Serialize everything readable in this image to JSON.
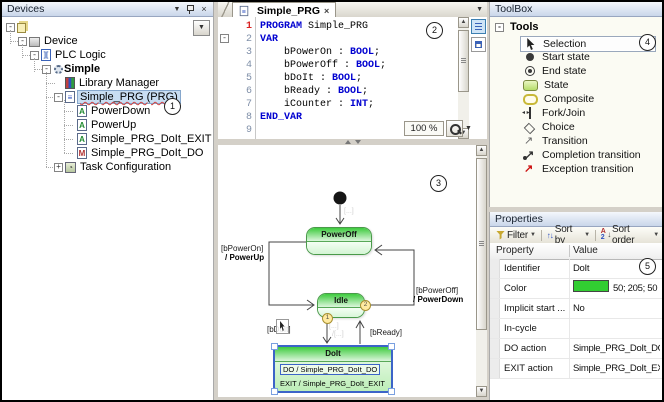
{
  "icons": {
    "close": "×",
    "dropdown": "▼",
    "up": "▲",
    "down": "▼"
  },
  "annotations": {
    "a1": "1",
    "a2": "2",
    "a3": "3",
    "a4": "4",
    "a5": "5"
  },
  "devices_panel": {
    "title": "Devices",
    "tree": [
      {
        "label": "",
        "level": 0,
        "icon": "project",
        "expander": "-",
        "name": "root"
      },
      {
        "label": "Device",
        "level": 1,
        "icon": "device",
        "expander": "-",
        "name": "device"
      },
      {
        "label": "PLC Logic",
        "level": 2,
        "icon": "plc",
        "expander": "-",
        "name": "plc-logic"
      },
      {
        "label": "Simple",
        "level": 3,
        "icon": "app",
        "expander": "-",
        "bold": true,
        "name": "simple"
      },
      {
        "label": "Library Manager",
        "level": 4,
        "icon": "library",
        "name": "library-manager"
      },
      {
        "label": "Simple_PRG (PRG)",
        "level": 4,
        "icon": "pou",
        "expander": "-",
        "selected": true,
        "annotation": "1",
        "name": "simple-prg"
      },
      {
        "label": "PowerDown",
        "level": 5,
        "icon": "action",
        "name": "powerdown"
      },
      {
        "label": "PowerUp",
        "level": 5,
        "icon": "action",
        "name": "powerup"
      },
      {
        "label": "Simple_PRG_DoIt_EXIT",
        "level": 5,
        "icon": "action",
        "name": "simple-prg-doit-exit"
      },
      {
        "label": "Simple_PRG_DoIt_DO",
        "level": 5,
        "icon": "method",
        "name": "simple-prg-doit-do"
      },
      {
        "label": "Task Configuration",
        "level": 4,
        "icon": "task",
        "expander": "+",
        "name": "task-configuration"
      }
    ]
  },
  "editor": {
    "tab_title": "Simple_PRG",
    "zoom_level": "100 %",
    "lines": [
      {
        "n": "1",
        "cur": true,
        "parts": [
          [
            "PROGRAM",
            "kw"
          ],
          [
            " Simple_PRG",
            "pl"
          ]
        ]
      },
      {
        "n": "2",
        "fold": true,
        "parts": [
          [
            "VAR",
            "kw"
          ]
        ]
      },
      {
        "n": "3",
        "parts": [
          [
            "    bPowerOn : ",
            "pl"
          ],
          [
            "BOOL",
            "ty"
          ],
          [
            ";",
            "pl"
          ]
        ]
      },
      {
        "n": "4",
        "parts": [
          [
            "    bPowerOff : ",
            "pl"
          ],
          [
            "BOOL",
            "ty"
          ],
          [
            ";",
            "pl"
          ]
        ]
      },
      {
        "n": "5",
        "parts": [
          [
            "    bDoIt : ",
            "pl"
          ],
          [
            "BOOL",
            "ty"
          ],
          [
            ";",
            "pl"
          ]
        ]
      },
      {
        "n": "6",
        "parts": [
          [
            "    bReady : ",
            "pl"
          ],
          [
            "BOOL",
            "ty"
          ],
          [
            ";",
            "pl"
          ]
        ]
      },
      {
        "n": "7",
        "parts": [
          [
            "    iCounter : ",
            "pl"
          ],
          [
            "INT",
            "ty"
          ],
          [
            ";",
            "pl"
          ]
        ]
      },
      {
        "n": "8",
        "parts": [
          [
            "END_VAR",
            "kw"
          ]
        ]
      },
      {
        "n": "9",
        "parts": []
      }
    ]
  },
  "diagram": {
    "states": {
      "poweroff": "PowerOff",
      "idle": "Idle",
      "doit_title": "DoIt",
      "doit_do": "DO / Simple_PRG_DoIt_DO",
      "doit_exit": "EXIT / Simple_PRG_DoIt_EXIT"
    },
    "transitions": {
      "power_on_guard": "[bPowerOn]",
      "power_on_action": "/ PowerUp",
      "power_off_guard": "[bPowerOff]",
      "power_off_action": "/ PowerDown",
      "doit_guard": "[bDoIt]",
      "ready_guard": "[bReady]",
      "hint_initial": "[...]",
      "hint_guard": "[...]",
      "hint_action": "/[...]",
      "badge_1": "1",
      "badge_2": "2"
    }
  },
  "toolbox": {
    "title": "ToolBox",
    "group": "Tools",
    "items": [
      {
        "label": "Selection",
        "icon": "selection",
        "selected": true
      },
      {
        "label": "Start state",
        "icon": "start-state"
      },
      {
        "label": "End state",
        "icon": "end-state"
      },
      {
        "label": "State",
        "icon": "state"
      },
      {
        "label": "Composite",
        "icon": "composite"
      },
      {
        "label": "Fork/Join",
        "icon": "fork-join"
      },
      {
        "label": "Choice",
        "icon": "choice"
      },
      {
        "label": "Transition",
        "icon": "transition"
      },
      {
        "label": "Completion transition",
        "icon": "completion-transition"
      },
      {
        "label": "Exception transition",
        "icon": "exception-transition"
      }
    ]
  },
  "properties": {
    "title": "Properties",
    "toolbar": {
      "filter": "Filter",
      "sort_by": "Sort by",
      "sort_order": "Sort order"
    },
    "columns": {
      "property": "Property",
      "value": "Value"
    },
    "rows": [
      {
        "label": "Identifier",
        "value": "DoIt",
        "type": "text"
      },
      {
        "label": "Color",
        "value": "50; 205; 50",
        "type": "color",
        "swatch": "#32cd32"
      },
      {
        "label": "Implicit start ...",
        "value": "No",
        "type": "text"
      },
      {
        "label": "In-cycle",
        "value": "",
        "type": "checkbox"
      },
      {
        "label": "DO action",
        "value": "Simple_PRG_DoIt_DO",
        "type": "text"
      },
      {
        "label": "EXIT action",
        "value": "Simple_PRG_DoIt_EXIT",
        "type": "text"
      }
    ]
  }
}
